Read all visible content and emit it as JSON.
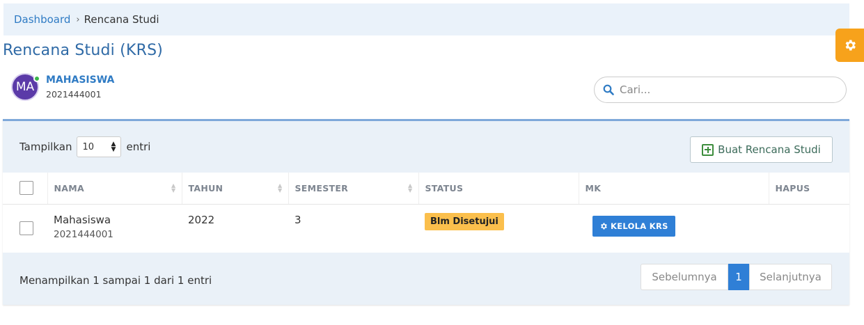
{
  "breadcrumb": {
    "home": "Dashboard",
    "separator": "›",
    "current": "Rencana Studi"
  },
  "page_title": "Rencana Studi (KRS)",
  "user": {
    "initials": "MA",
    "name": "MAHASISWA",
    "id": "2021444001",
    "status": "online"
  },
  "search": {
    "placeholder": "Cari..."
  },
  "table_controls": {
    "show_label": "Tampilkan",
    "page_size": "10",
    "entries_label": "entri",
    "create_button": "Buat Rencana Studi"
  },
  "table": {
    "headers": {
      "nama": "NAMA",
      "tahun": "TAHUN",
      "semester": "SEMESTER",
      "status": "STATUS",
      "mk": "MK",
      "hapus": "HAPUS"
    },
    "rows": [
      {
        "name": "Mahasiswa",
        "id": "2021444001",
        "tahun": "2022",
        "semester": "3",
        "status": "Blm Disetujui",
        "action": "KELOLA KRS"
      }
    ]
  },
  "footer": {
    "info": "Menampilkan 1 sampai 1 dari 1 entri",
    "prev": "Sebelumnya",
    "page": "1",
    "next": "Selanjutnya"
  },
  "colors": {
    "accent": "#2f7fd6",
    "settings_tab": "#f7a21b",
    "status_badge": "#fbbf4c",
    "online": "#3bb54a"
  },
  "icons": {
    "settings": "gear-icon",
    "search": "search-icon",
    "create": "plus-square-icon",
    "kelola": "gear-icon"
  }
}
